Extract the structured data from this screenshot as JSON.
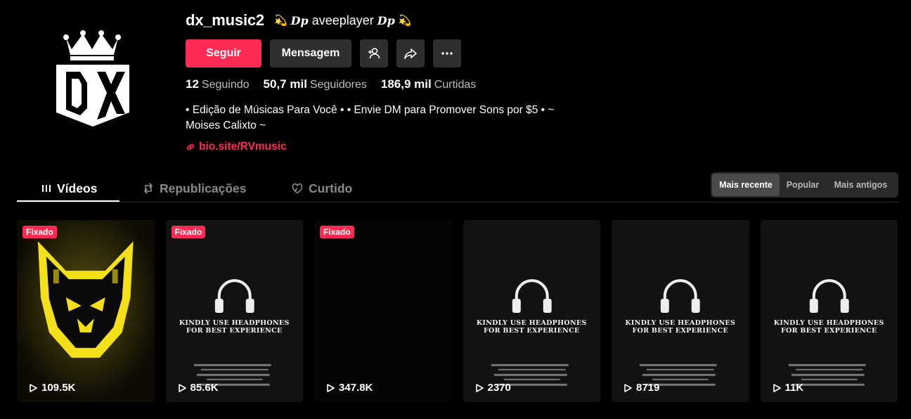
{
  "profile": {
    "username": "dx_music2",
    "nickname_text": "aveeplayer",
    "nickname_symbol": "Dp",
    "deco_symbol": "💫",
    "avatar_text": "DX",
    "follow_label": "Seguir",
    "message_label": "Mensagem",
    "stats": [
      {
        "count": "12",
        "label": "Seguindo"
      },
      {
        "count": "50,7 mil",
        "label": "Seguidores"
      },
      {
        "count": "186,9 mil",
        "label": "Curtidas"
      }
    ],
    "bio_line1": "• Edição de Músicas Para Você • • Envie DM para Promover Sons por $5 • ~",
    "bio_line2": "Moises Calixto ~",
    "link": "bio.site/RVmusic"
  },
  "tabs": [
    {
      "label": "Vídeos",
      "icon": "grid-bars-icon",
      "active": true
    },
    {
      "label": "Republicações",
      "icon": "repost-icon",
      "active": false
    },
    {
      "label": "Curtido",
      "icon": "heart-hidden-icon",
      "active": false
    }
  ],
  "sort": {
    "options": [
      "Mais recente",
      "Popular",
      "Mais antigos"
    ],
    "selected": "Mais recente"
  },
  "videos": [
    {
      "pinned_label": "Fixado",
      "views": "109.5K",
      "thumb": "yellow-cat"
    },
    {
      "pinned_label": "Fixado",
      "views": "85.6K",
      "thumb": "headphones"
    },
    {
      "pinned_label": "Fixado",
      "views": "347.8K",
      "thumb": "black"
    },
    {
      "pinned_label": "",
      "views": "2370",
      "thumb": "headphones"
    },
    {
      "pinned_label": "",
      "views": "8719",
      "thumb": "headphones"
    },
    {
      "pinned_label": "",
      "views": "11K",
      "thumb": "headphones"
    }
  ],
  "headphones_text": {
    "line1": "KINDLY USE HEADPHONES",
    "line2": "FOR BEST EXPERIENCE"
  },
  "colors": {
    "accent": "#fe2c55",
    "background": "#000000",
    "button_dark": "#2f2f2f",
    "thumb_yellow": "#f4e01a"
  }
}
